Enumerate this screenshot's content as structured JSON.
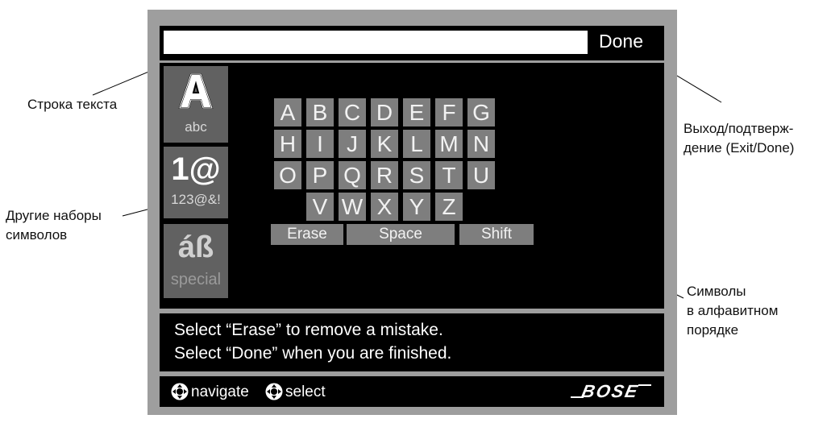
{
  "callouts": {
    "text_line": "Строка текста",
    "exit_done": [
      "Выход/подтверж-",
      "дение (Exit/Done)"
    ],
    "other_sets": [
      "Другие наборы",
      "символов"
    ],
    "alphabetical": [
      "Символы",
      "в алфавитном",
      "порядке"
    ]
  },
  "top_bar": {
    "text_field_value": "",
    "done_label": "Done"
  },
  "char_sets": [
    {
      "icon": "letter-a-icon",
      "glyph": "A",
      "label": "abc",
      "selected": true
    },
    {
      "icon": "one-at-icon",
      "glyph": "1@",
      "label": "123@&!",
      "selected": false
    },
    {
      "icon": "accent-beta-icon",
      "glyph": "áß",
      "label": "special",
      "selected": false
    }
  ],
  "keyboard": {
    "rows": [
      [
        "A",
        "B",
        "C",
        "D",
        "E",
        "F",
        "G"
      ],
      [
        "H",
        "I",
        "J",
        "K",
        "L",
        "M",
        "N"
      ],
      [
        "O",
        "P",
        "Q",
        "R",
        "S",
        "T",
        "U"
      ],
      [
        "V",
        "W",
        "X",
        "Y",
        "Z"
      ]
    ],
    "erase_label": "Erase",
    "space_label": "Space",
    "shift_label": "Shift"
  },
  "message": [
    "Select “Erase” to remove a mistake.",
    "Select “Done” when you are finished."
  ],
  "status_bar": {
    "navigate_label": "navigate",
    "select_label": "select",
    "brand": "BOSE"
  },
  "colors": {
    "frame": "#9e9e9e",
    "screen_bg": "#000000",
    "key_bg": "#7e7e7e",
    "set_bg": "#616161"
  }
}
